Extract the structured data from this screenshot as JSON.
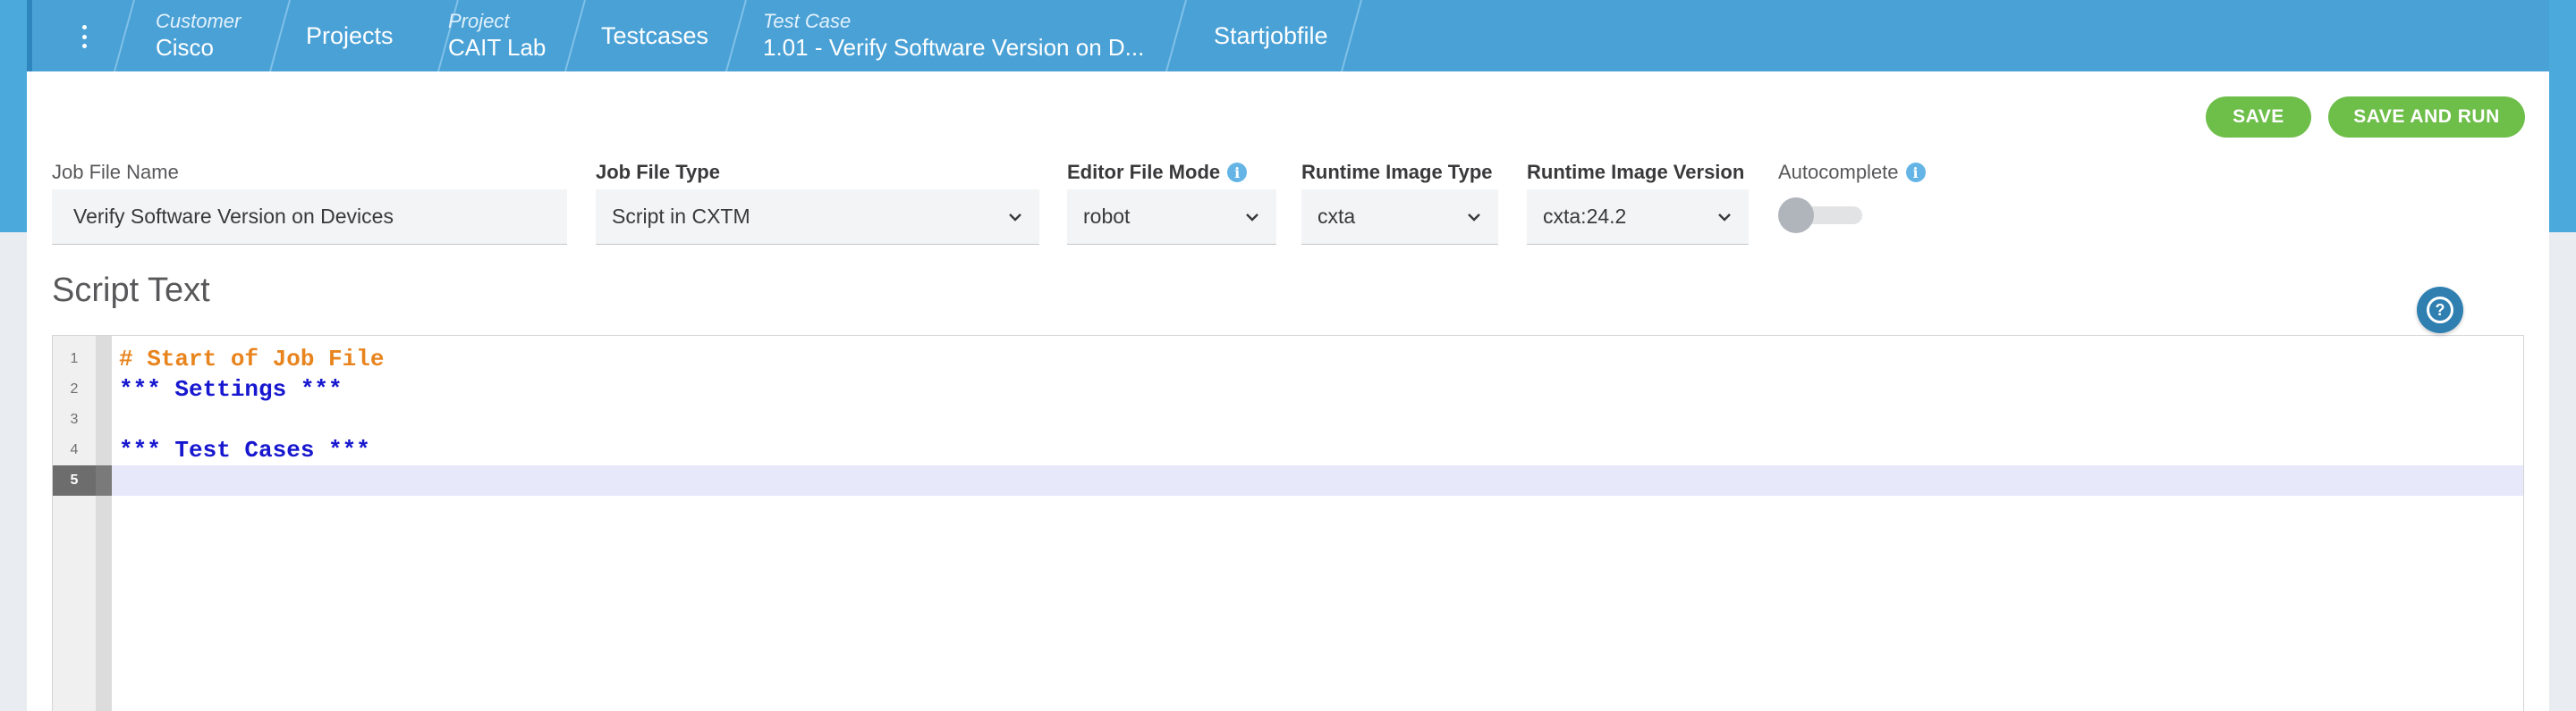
{
  "breadcrumbs": [
    {
      "sub": "Customer",
      "main": "Cisco"
    },
    {
      "sub": "",
      "main": "Projects"
    },
    {
      "sub": "Project",
      "main": "CAIT Lab"
    },
    {
      "sub": "",
      "main": "Testcases"
    },
    {
      "sub": "Test Case",
      "main": "1.01 - Verify Software Version on D..."
    },
    {
      "sub": "",
      "main": "Startjobfile"
    }
  ],
  "actions": {
    "save_label": "SAVE",
    "save_run_label": "SAVE AND RUN"
  },
  "form": {
    "job_file_name": {
      "label": "Job File Name",
      "value": "Verify Software Version on Devices"
    },
    "job_file_type": {
      "label": "Job File Type",
      "value": "Script in CXTM"
    },
    "editor_file_mode": {
      "label": "Editor File Mode",
      "value": "robot"
    },
    "runtime_image_type": {
      "label": "Runtime Image Type",
      "value": "cxta"
    },
    "runtime_image_version": {
      "label": "Runtime Image Version",
      "value": "cxta:24.2"
    },
    "autocomplete": {
      "label": "Autocomplete",
      "enabled": false
    }
  },
  "script": {
    "title": "Script Text",
    "lines": [
      {
        "n": "1",
        "text": "# Start of Job File",
        "kind": "comment"
      },
      {
        "n": "2",
        "text": "*** Settings ***",
        "kind": "keyword"
      },
      {
        "n": "3",
        "text": "",
        "kind": "plain"
      },
      {
        "n": "4",
        "text": "*** Test Cases ***",
        "kind": "keyword"
      },
      {
        "n": "5",
        "text": "",
        "kind": "plain"
      }
    ],
    "active_line": "5"
  },
  "colors": {
    "header": "#4aa1d6",
    "button": "#6ebe4a",
    "comment": "#e8841e",
    "keyword": "#1717cf"
  },
  "icons": [
    "kebab-menu-icon",
    "info-icon",
    "chevron-down-icon",
    "help-icon"
  ]
}
